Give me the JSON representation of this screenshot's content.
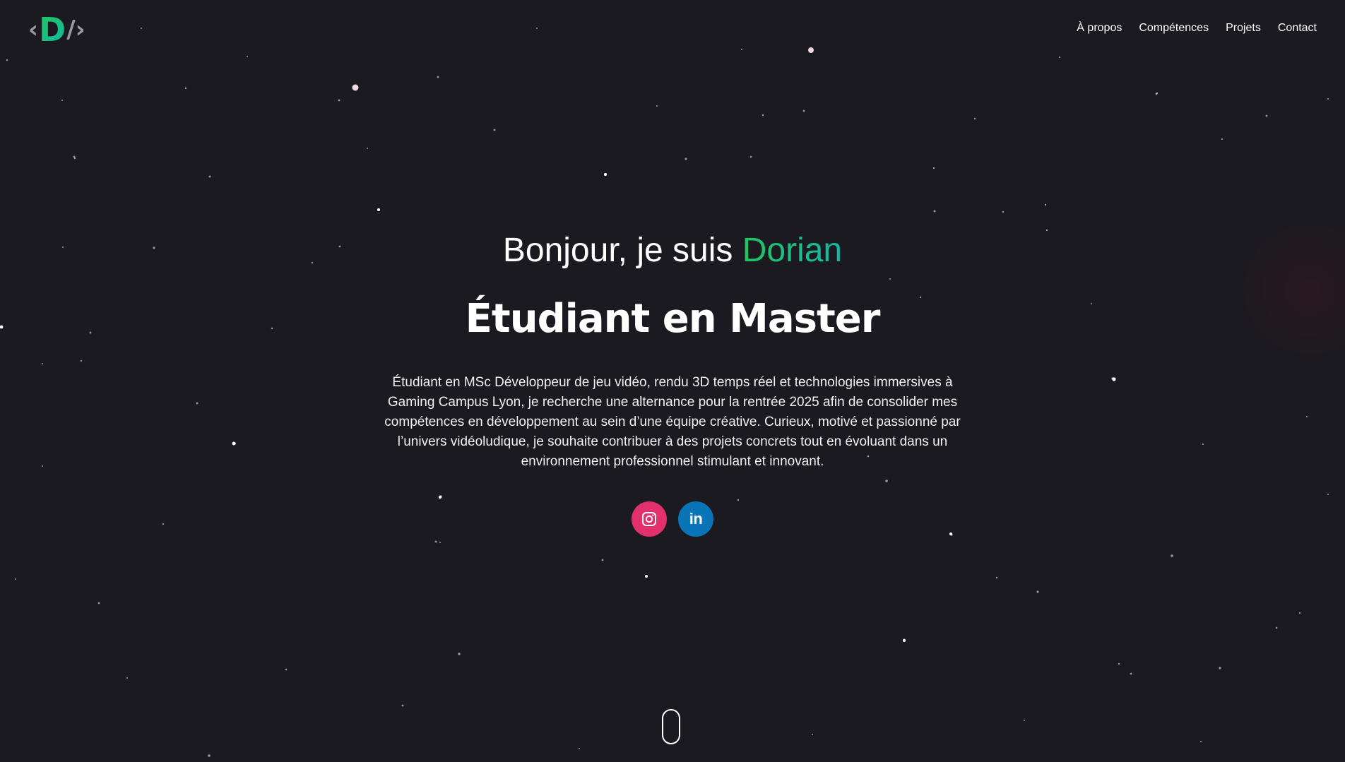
{
  "header": {
    "logo": {
      "left_bracket": "‹",
      "letter": "D",
      "slash": "/",
      "right_bracket": "›"
    },
    "nav": [
      {
        "label": "À propos"
      },
      {
        "label": "Compétences"
      },
      {
        "label": "Projets"
      },
      {
        "label": "Contact"
      }
    ]
  },
  "hero": {
    "greeting_prefix": "Bonjour, je suis ",
    "name": "Dorian",
    "role": "Étudiant en Master",
    "description": "Étudiant en MSc Développeur de jeu vidéo, rendu 3D temps réel et technologies immersives à Gaming Campus Lyon, je recherche une alternance pour la rentrée 2025 afin de consolider mes compétences en développement au sein d’une équipe créative. Curieux, motivé et passionné par l’univers vidéoludique, je souhaite contribuer à des projets concrets tout en évoluant dans un environnement professionnel stimulant et innovant.",
    "socials": [
      {
        "icon": "instagram-icon",
        "color": "#e1306c"
      },
      {
        "icon": "linkedin-icon",
        "label": "in",
        "color": "#0a74b8"
      }
    ]
  },
  "colors": {
    "background": "#1a1a20",
    "accent_green": "#22c55e",
    "accent_teal": "#14b8a6",
    "text": "#ffffff"
  }
}
